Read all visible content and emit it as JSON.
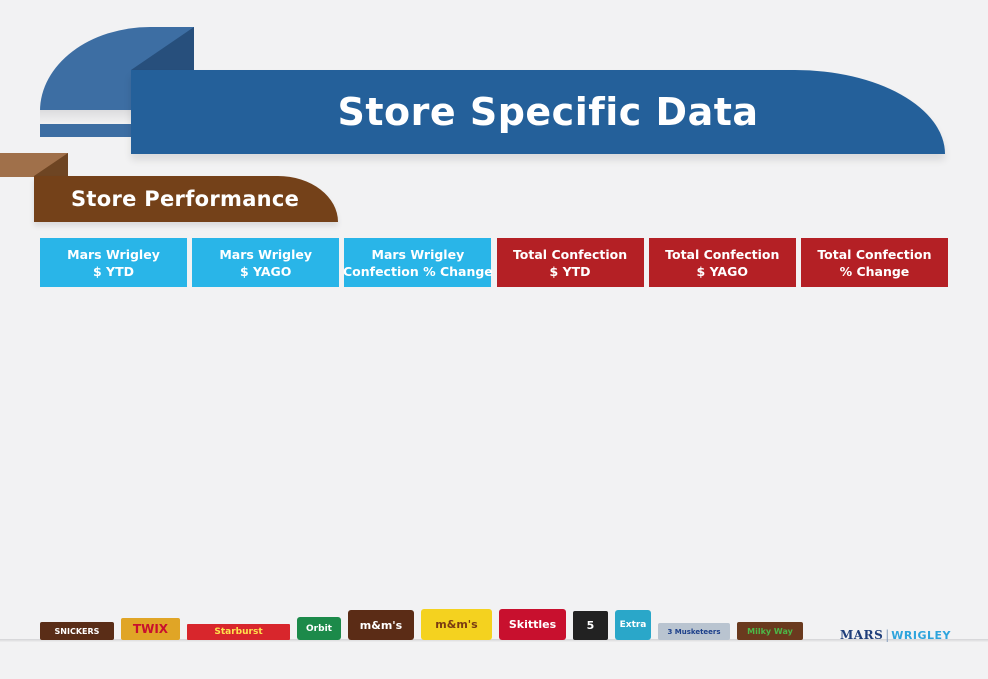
{
  "header": {
    "title": "Store Specific Data",
    "accent_color": "#24609a"
  },
  "section": {
    "title": "Store Performance",
    "accent_color": "#744119"
  },
  "columns": [
    {
      "line1": "Mars Wrigley",
      "line2": "$ YTD",
      "color": "#29b5e8"
    },
    {
      "line1": "Mars Wrigley",
      "line2": "$ YAGO",
      "color": "#29b5e8"
    },
    {
      "line1": "Mars Wrigley",
      "line2": "Confection % Change",
      "color": "#29b5e8"
    },
    {
      "line1": "Total Confection",
      "line2": "$ YTD",
      "color": "#b42025"
    },
    {
      "line1": "Total Confection",
      "line2": "$ YAGO",
      "color": "#b42025"
    },
    {
      "line1": "Total Confection",
      "line2": "% Change",
      "color": "#b42025"
    }
  ],
  "products": [
    {
      "label": "SNICKERS",
      "color": "#5a2d17",
      "text_color": "#ffffff"
    },
    {
      "label": "TWIX",
      "color": "#e0a526",
      "text_color": "#c8102e"
    },
    {
      "label": "Starburst",
      "color": "#d8262c",
      "text_color": "#ffe14d"
    },
    {
      "label": "Orbit",
      "color": "#1c8a4a",
      "text_color": "#ffffff"
    },
    {
      "label": "m&m's",
      "color": "#5b2c16",
      "text_color": "#ffffff"
    },
    {
      "label": "m&m's",
      "color": "#f4d21f",
      "text_color": "#7a3b12"
    },
    {
      "label": "Skittles",
      "color": "#c8102e",
      "text_color": "#ffffff"
    },
    {
      "label": "5",
      "color": "#222222",
      "text_color": "#ffffff"
    },
    {
      "label": "Extra",
      "color": "#2aa7c9",
      "text_color": "#ffffff"
    },
    {
      "label": "3 Musketeers",
      "color": "#b9c4d0",
      "text_color": "#1c3f8a"
    },
    {
      "label": "Milky Way",
      "color": "#6a3a1e",
      "text_color": "#4cb848"
    }
  ],
  "brand": {
    "mars": "MARS",
    "wrigley": "WRIGLEY"
  }
}
